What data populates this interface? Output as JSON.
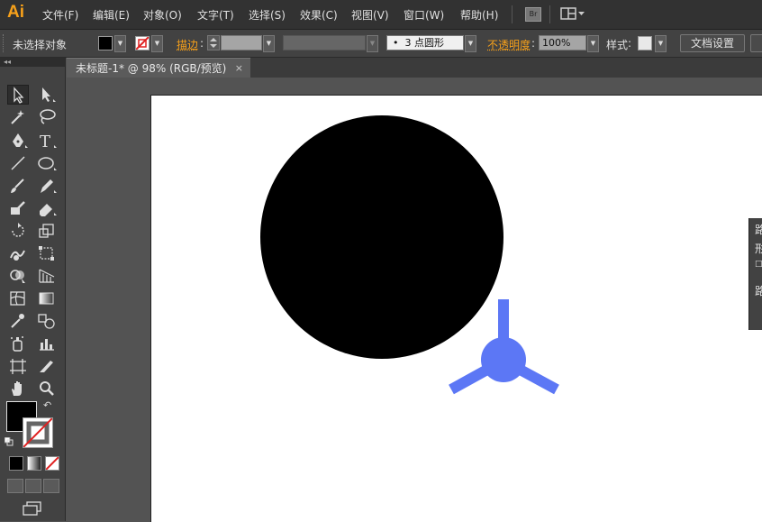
{
  "app": {
    "logo": "Ai"
  },
  "menu": [
    "文件(F)",
    "编辑(E)",
    "对象(O)",
    "文字(T)",
    "选择(S)",
    "效果(C)",
    "视图(V)",
    "窗口(W)",
    "帮助(H)"
  ],
  "bridge_label": "Br",
  "control": {
    "selection_status": "未选择对象",
    "stroke_label": "描边",
    "brush_value": "3 点圆形",
    "opacity_label": "不透明度",
    "opacity_value": "100%",
    "style_label": "样式",
    "doc_setup_button": "文档设置"
  },
  "document_tab": {
    "title": "未标题-1* @ 98% (RGB/预览)",
    "close": "×"
  },
  "panel_collapse": "◂◂",
  "floating_panel": [
    "路",
    "形",
    "□",
    "路"
  ],
  "colors": {
    "logo": "#f7a11a",
    "accent_label": "#f7a11a",
    "fill": "#000000",
    "stroke": "none",
    "circle": "#000000",
    "tripod": "#5c77f5"
  }
}
